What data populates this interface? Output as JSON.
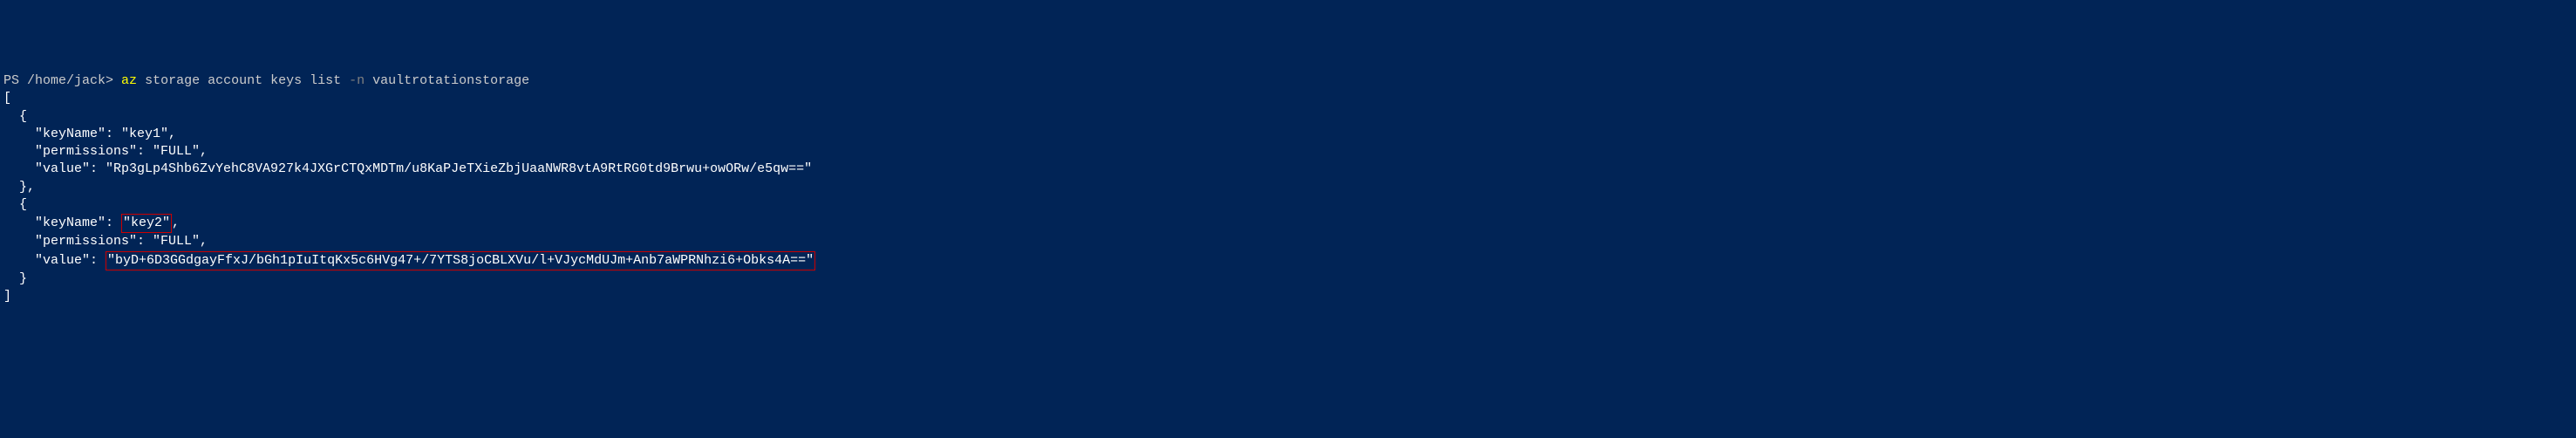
{
  "prompt": {
    "prefix": "PS ",
    "path": "/home/jack",
    "separator": "> ",
    "cmd_az": "az",
    "cmd_args1": " storage account keys list ",
    "cmd_flag": "-n",
    "cmd_args2": " vaultrotationstorage"
  },
  "output": {
    "line1": "[",
    "line2": "  {",
    "line3_a": "    \"keyName\": ",
    "line3_b": "\"key1\"",
    "line3_c": ",",
    "line4": "    \"permissions\": \"FULL\",",
    "line5": "    \"value\": \"Rp3gLp4Shb6ZvYehC8VA927k4JXGrCTQxMDTm/u8KaPJeTXieZbjUaaNWR8vtA9RtRG0td9Brwu+owORw/e5qw==\"",
    "line6": "  },",
    "line7": "  {",
    "line8_a": "    \"keyName\": ",
    "line8_b": "\"key2\"",
    "line8_c": ",",
    "line9": "    \"permissions\": \"FULL\",",
    "line10_a": "    \"value\": ",
    "line10_b": "\"byD+6D3GGdgayFfxJ/bGh1pIuItqKx5c6HVg47+/7YTS8joCBLXVu/l+VJycMdUJm+Anb7aWPRNhzi6+Obks4A==\"",
    "line11": "  }",
    "line12": "]"
  }
}
